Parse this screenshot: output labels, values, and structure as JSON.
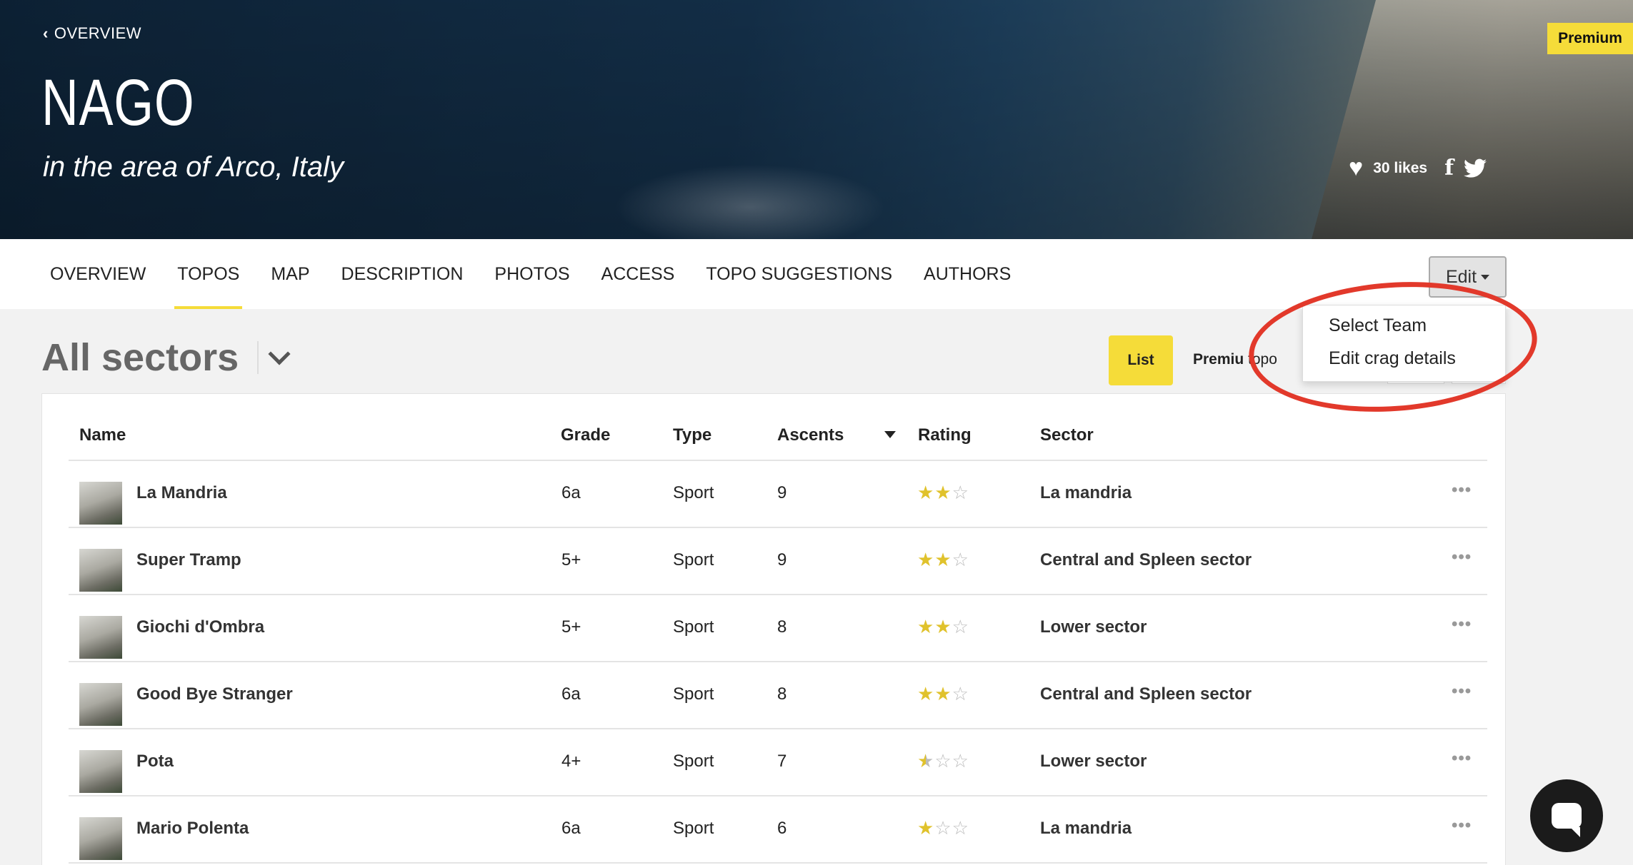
{
  "hero": {
    "back_label": "OVERVIEW",
    "title": "NAGO",
    "subtitle": "in the area of Arco, Italy",
    "premium_badge": "Premium",
    "likes": "30 likes",
    "facebook_glyph": "f"
  },
  "nav": {
    "tabs": [
      {
        "label": "OVERVIEW",
        "active": false
      },
      {
        "label": "TOPOS",
        "active": true
      },
      {
        "label": "MAP",
        "active": false
      },
      {
        "label": "DESCRIPTION",
        "active": false
      },
      {
        "label": "PHOTOS",
        "active": false
      },
      {
        "label": "ACCESS",
        "active": false
      },
      {
        "label": "TOPO SUGGESTIONS",
        "active": false
      },
      {
        "label": "AUTHORS",
        "active": false
      }
    ],
    "edit_label": "Edit"
  },
  "dropdown": {
    "items": [
      "Select Team",
      "Edit crag details"
    ]
  },
  "toolbar": {
    "sector_title": "All sectors",
    "list_label": "List",
    "premium_bold": "Premiu",
    "premium_rest": "topo"
  },
  "table": {
    "headers": {
      "name": "Name",
      "grade": "Grade",
      "type": "Type",
      "ascents": "Ascents",
      "rating": "Rating",
      "sector": "Sector"
    },
    "rows": [
      {
        "name": "La Mandria",
        "grade": "6a",
        "type": "Sport",
        "ascents": "9",
        "rating": 2,
        "sector": "La mandria"
      },
      {
        "name": "Super Tramp",
        "grade": "5+",
        "type": "Sport",
        "ascents": "9",
        "rating": 2,
        "sector": "Central and Spleen sector"
      },
      {
        "name": "Giochi d'Ombra",
        "grade": "5+",
        "type": "Sport",
        "ascents": "8",
        "rating": 2,
        "sector": "Lower sector"
      },
      {
        "name": "Good Bye Stranger",
        "grade": "6a",
        "type": "Sport",
        "ascents": "8",
        "rating": 2,
        "sector": "Central and Spleen sector"
      },
      {
        "name": "Pota",
        "grade": "4+",
        "type": "Sport",
        "ascents": "7",
        "rating": 0.5,
        "sector": "Lower sector"
      },
      {
        "name": "Mario Polenta",
        "grade": "6a",
        "type": "Sport",
        "ascents": "6",
        "rating": 1,
        "sector": "La mandria"
      }
    ],
    "more_glyph": "•••"
  },
  "colors": {
    "accent": "#f5dc39",
    "annotation": "#e2392b",
    "hero": "#14304a"
  },
  "icons": [
    "chevron-left-icon",
    "heart-icon",
    "facebook-icon",
    "twitter-icon",
    "chevron-down-icon",
    "sort-down-icon",
    "more-icon",
    "star-icon",
    "chat-icon"
  ]
}
